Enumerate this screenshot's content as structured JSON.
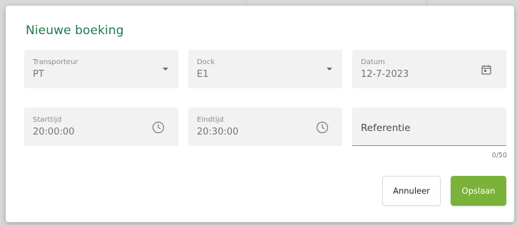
{
  "dialog": {
    "title": "Nieuwe boeking"
  },
  "fields": {
    "transporteur": {
      "label": "Transporteur",
      "value": "PT"
    },
    "dock": {
      "label": "Dock",
      "value": "E1"
    },
    "datum": {
      "label": "Datum",
      "value": "12-7-2023"
    },
    "starttijd": {
      "label": "Starttijd",
      "value": "20:00:00"
    },
    "eindtijd": {
      "label": "Eindtijd",
      "value": "20:30:00"
    },
    "referentie": {
      "label": "Referentie",
      "value": "",
      "counter": "0/50"
    }
  },
  "buttons": {
    "cancel_label": "Annuleer",
    "save_label": "Opslaan"
  },
  "icons": {
    "dropdown": "chevron-down-icon",
    "date": "calendar-icon",
    "time": "clock-icon"
  },
  "colors": {
    "title": "#1e7a4c",
    "primary_button": "#7ab23a",
    "field_background": "#f2f2f2"
  }
}
